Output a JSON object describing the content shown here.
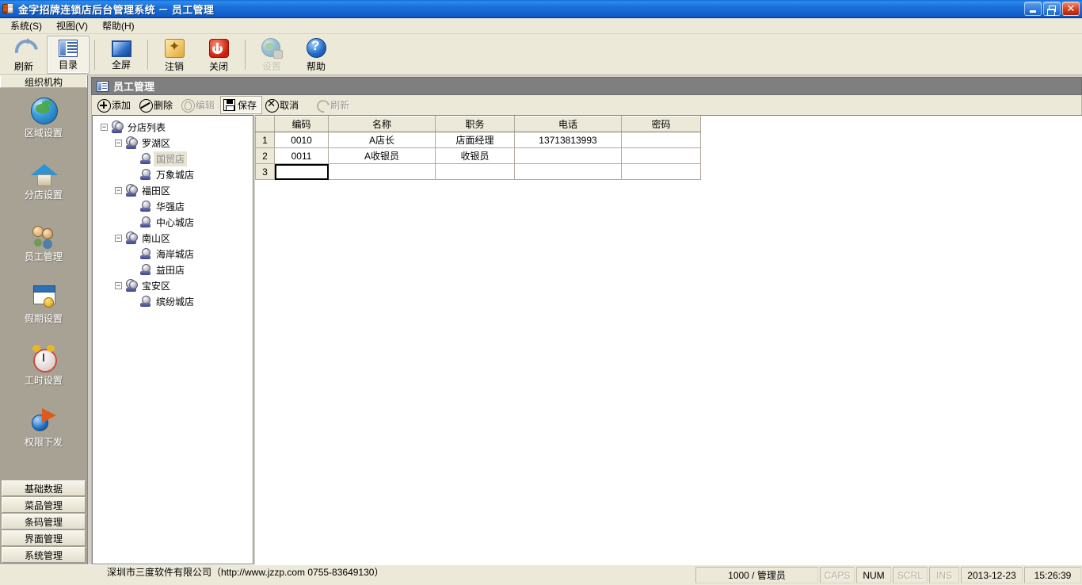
{
  "window": {
    "title": "金字招牌连锁店后台管理系统  －  员工管理",
    "icon": "server-icon",
    "minimize_label": "最小化",
    "maximize_label": "还原",
    "close_label": "关闭"
  },
  "menubar": {
    "items": [
      {
        "label": "系统(S)",
        "name": "menu-system"
      },
      {
        "label": "视图(V)",
        "name": "menu-view"
      },
      {
        "label": "帮助(H)",
        "name": "menu-help"
      }
    ]
  },
  "toolbar": {
    "buttons": [
      {
        "label": "刷新",
        "icon": "refresh-icon",
        "state": "normal"
      },
      {
        "label": "目录",
        "icon": "catalog-icon",
        "state": "pressed"
      },
      {
        "label": "全屏",
        "icon": "fullscreen-icon",
        "state": "normal"
      },
      {
        "label": "注销",
        "icon": "key-icon",
        "state": "normal"
      },
      {
        "label": "关闭",
        "icon": "power-icon",
        "state": "normal"
      },
      {
        "label": "设置",
        "icon": "globe-settings-icon",
        "state": "disabled"
      },
      {
        "label": "帮助",
        "icon": "help-icon",
        "state": "normal"
      }
    ]
  },
  "sidebar": {
    "header": "组织机构",
    "items": [
      {
        "label": "区域设置",
        "icon": "globe-icon"
      },
      {
        "label": "分店设置",
        "icon": "house-icon"
      },
      {
        "label": "员工管理",
        "icon": "people-icon"
      },
      {
        "label": "假期设置",
        "icon": "calendar-icon"
      },
      {
        "label": "工时设置",
        "icon": "alarm-clock-icon"
      },
      {
        "label": "权限下发",
        "icon": "permission-icon"
      }
    ],
    "bottom_buttons": [
      {
        "label": "基础数据"
      },
      {
        "label": "菜品管理"
      },
      {
        "label": "条码管理"
      },
      {
        "label": "界面管理"
      },
      {
        "label": "系统管理"
      }
    ]
  },
  "panel": {
    "title": "员工管理",
    "title_icon": "list-icon",
    "actions": [
      {
        "label": "添加",
        "icon": "add-circle-icon",
        "state": "normal"
      },
      {
        "label": "删除",
        "icon": "delete-circle-icon",
        "state": "normal"
      },
      {
        "label": "编辑",
        "icon": "edit-circle-icon",
        "state": "disabled"
      },
      {
        "label": "保存",
        "icon": "save-icon",
        "state": "pressed"
      },
      {
        "label": "取消",
        "icon": "cancel-circle-icon",
        "state": "normal"
      },
      {
        "label": "刷新",
        "icon": "refresh-icon",
        "state": "disabled"
      }
    ]
  },
  "tree": {
    "root_label": "分店列表",
    "nodes": [
      {
        "label": "分店列表",
        "level": 0,
        "type": "group",
        "expanded": true,
        "selected": false
      },
      {
        "label": "罗湖区",
        "level": 1,
        "type": "group",
        "expanded": true,
        "selected": false
      },
      {
        "label": "国贸店",
        "level": 2,
        "type": "leaf",
        "expanded": null,
        "selected": true
      },
      {
        "label": "万象城店",
        "level": 2,
        "type": "leaf",
        "expanded": null,
        "selected": false
      },
      {
        "label": "福田区",
        "level": 1,
        "type": "group",
        "expanded": true,
        "selected": false
      },
      {
        "label": "华强店",
        "level": 2,
        "type": "leaf",
        "expanded": null,
        "selected": false
      },
      {
        "label": "中心城店",
        "level": 2,
        "type": "leaf",
        "expanded": null,
        "selected": false
      },
      {
        "label": "南山区",
        "level": 1,
        "type": "group",
        "expanded": true,
        "selected": false
      },
      {
        "label": "海岸城店",
        "level": 2,
        "type": "leaf",
        "expanded": null,
        "selected": false
      },
      {
        "label": "益田店",
        "level": 2,
        "type": "leaf",
        "expanded": null,
        "selected": false
      },
      {
        "label": "宝安区",
        "level": 1,
        "type": "group",
        "expanded": true,
        "selected": false
      },
      {
        "label": "缤纷城店",
        "level": 2,
        "type": "leaf",
        "expanded": null,
        "selected": false
      }
    ]
  },
  "grid": {
    "columns": [
      "编码",
      "名称",
      "职务",
      "电话",
      "密码"
    ],
    "rows": [
      {
        "num": "1",
        "cells": [
          "0010",
          "A店长",
          "店面经理",
          "13713813993",
          ""
        ]
      },
      {
        "num": "2",
        "cells": [
          "0011",
          "A收银员",
          "收银员",
          "",
          ""
        ]
      },
      {
        "num": "3",
        "cells": [
          "",
          "",
          "",
          "",
          ""
        ]
      }
    ],
    "active_cell": {
      "row": 2,
      "col": 0
    }
  },
  "statusbar": {
    "company": "深圳市三度软件有限公司（http://www.jzzp.com  0755-83649130）",
    "user": "1000 / 管理员",
    "indicators": [
      {
        "label": "CAPS",
        "active": false
      },
      {
        "label": "NUM",
        "active": true
      },
      {
        "label": "SCRL",
        "active": false
      },
      {
        "label": "INS",
        "active": false
      }
    ],
    "date": "2013-12-23",
    "time": "15:26:39"
  },
  "colors": {
    "titlebar_blue": "#1B6FD8",
    "toolbar_beige": "#ECE9D8",
    "sidebar_gray": "#A8A294",
    "panel_header_gray": "#7F7F7F",
    "selection_beige": "#E8E4D4"
  }
}
